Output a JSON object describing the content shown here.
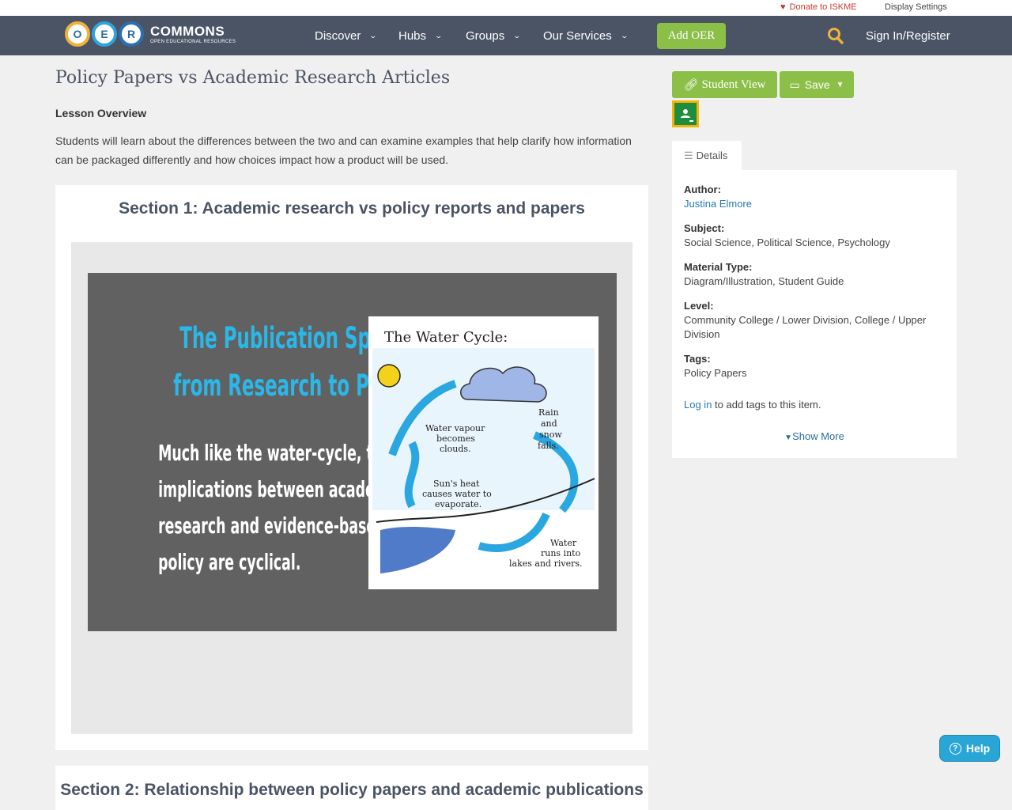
{
  "utility": {
    "donate": "Donate to ISKME",
    "display_settings": "Display Settings"
  },
  "brand": {
    "logo_letters": [
      "O",
      "E",
      "R"
    ],
    "name": "COMMONS",
    "tagline": "OPEN EDUCATIONAL RESOURCES"
  },
  "nav": {
    "items": [
      {
        "label": "Discover"
      },
      {
        "label": "Hubs"
      },
      {
        "label": "Groups"
      },
      {
        "label": "Our Services"
      }
    ],
    "add_oer": "Add OER",
    "search_icon": "search-icon",
    "sign_in": "Sign In/Register"
  },
  "main": {
    "title": "Policy Papers vs Academic Research Articles",
    "overview_heading": "Lesson Overview",
    "overview_text": "Students will learn about the differences between the two and can examine examples  that help clarify how information can be packaged differently and how choices impact how a product will be used.",
    "section1": {
      "title": "Section 1: Academic research vs policy reports and papers",
      "slide": {
        "heading_line1": "The Publication Spectrum",
        "heading_line2": "from Research to Policy",
        "body_lines": [
          "Much like the water-cycle, the",
          "implications between academic",
          "research and evidence-based",
          "policy are cyclical."
        ],
        "diagram": {
          "title": "The Water Cycle:",
          "label_vapour": "Water vapour becomes clouds.",
          "label_rain": "Rain and snow falls.",
          "label_heat": "Sun's heat causes water to evaporate.",
          "label_runs": "Water runs into lakes and rivers."
        }
      }
    },
    "section2": {
      "title": "Section 2: Relationship between policy papers and academic publications"
    }
  },
  "sidebar": {
    "student_view": "Student View",
    "save": "Save",
    "details_tab": "Details",
    "author_label": "Author:",
    "author": "Justina Elmore",
    "subject_label": "Subject:",
    "subject": "Social Science, Political Science, Psychology",
    "material_label": "Material Type:",
    "material": "Diagram/Illustration, Student Guide",
    "level_label": "Level:",
    "level": "Community College / Lower Division, College / Upper Division",
    "tags_label": "Tags:",
    "tags": "Policy Papers",
    "login_link": "Log in",
    "login_suffix": " to add tags to this item.",
    "show_more": "Show More"
  },
  "help": {
    "label": "Help"
  },
  "colors": {
    "navbar": "#4a5465",
    "accent_green": "#8bbf48",
    "link_blue": "#2a7ab0",
    "donate_red": "#c43a31",
    "help_blue": "#2aa6d6"
  }
}
